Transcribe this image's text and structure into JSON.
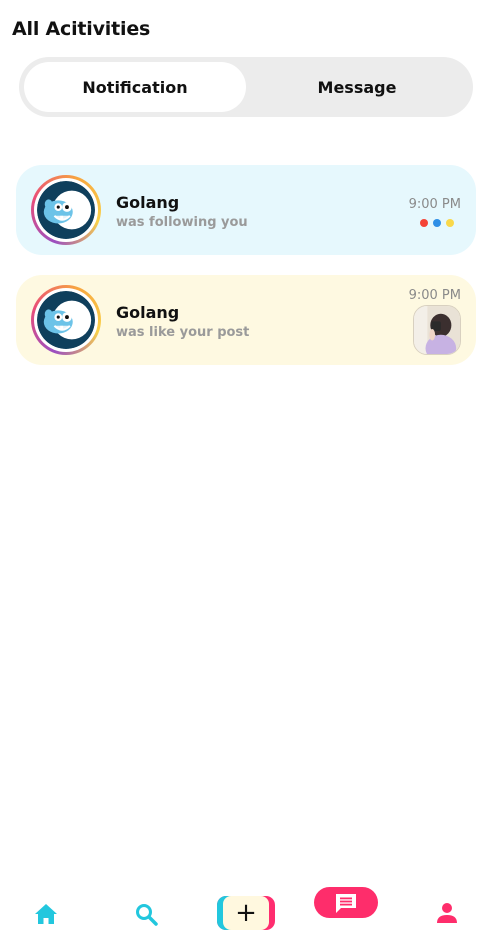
{
  "header": {
    "title": "All Acitivities"
  },
  "tabs": [
    {
      "label": "Notification",
      "active": true
    },
    {
      "label": "Message",
      "active": false
    }
  ],
  "notifications": [
    {
      "name": "Golang",
      "text": "was following you",
      "time": "9:00 PM",
      "background": "#e6f8fd",
      "indicator_colors": [
        "#f44336",
        "#2f8fe6",
        "#f9d84a"
      ]
    },
    {
      "name": "Golang",
      "text": "was like your post",
      "time": "9:00 PM",
      "background": "#fef9e1"
    }
  ],
  "bottom_nav": {
    "items": [
      "home-icon",
      "search-icon",
      "add-icon",
      "message-icon",
      "profile-icon"
    ],
    "add_symbol": "+"
  },
  "colors": {
    "accent_cyan": "#22c7de",
    "accent_pink": "#fe2d6b"
  }
}
